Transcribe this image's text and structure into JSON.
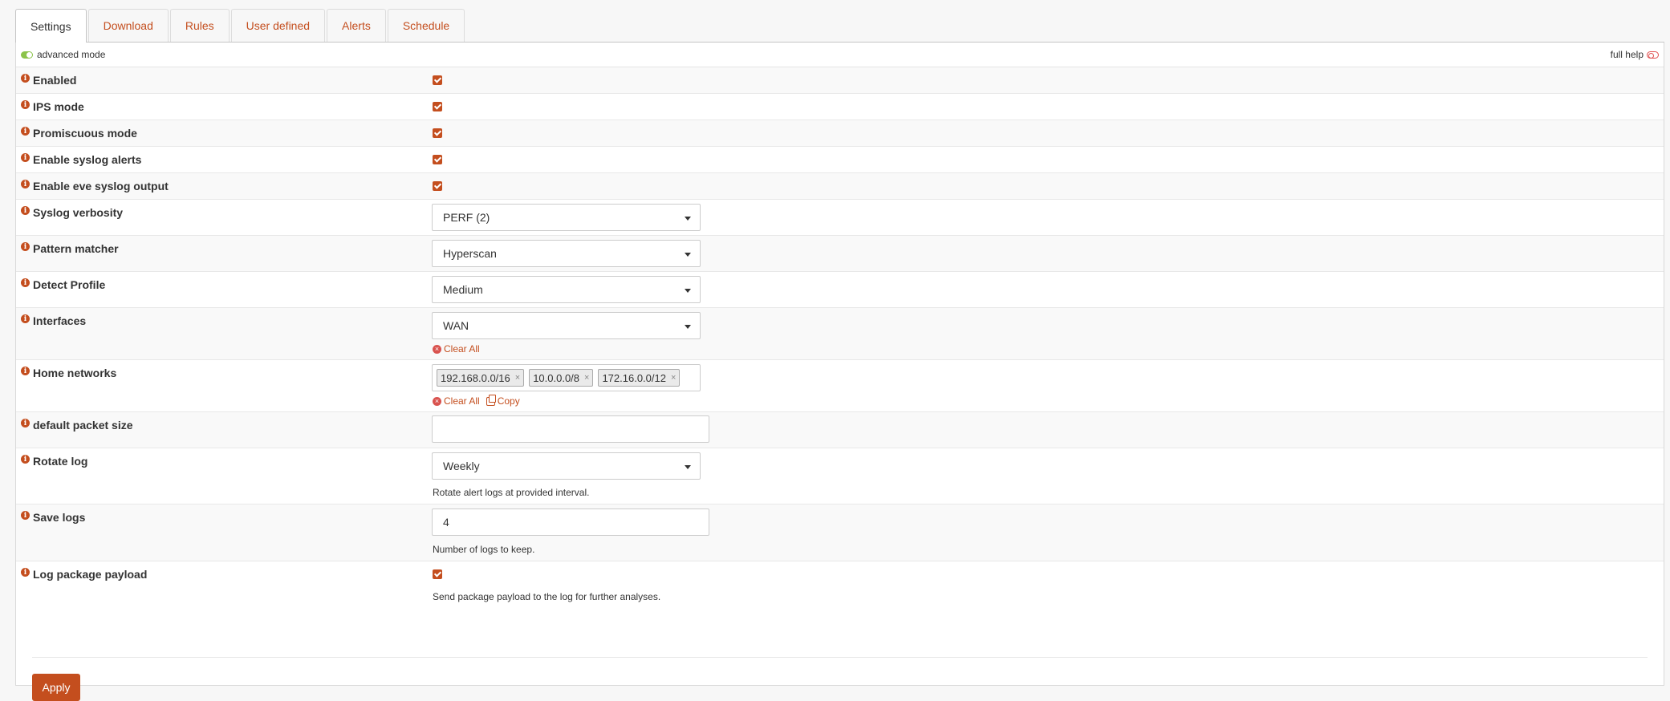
{
  "tabs": [
    {
      "label": "Settings",
      "active": true
    },
    {
      "label": "Download"
    },
    {
      "label": "Rules"
    },
    {
      "label": "User defined"
    },
    {
      "label": "Alerts"
    },
    {
      "label": "Schedule"
    }
  ],
  "modebar": {
    "advanced": "advanced mode",
    "full_help": "full help"
  },
  "fields": {
    "enabled": {
      "label": "Enabled",
      "checked": true
    },
    "ips_mode": {
      "label": "IPS mode",
      "checked": true
    },
    "promiscuous": {
      "label": "Promiscuous mode",
      "checked": true
    },
    "syslog_alerts": {
      "label": "Enable syslog alerts",
      "checked": true
    },
    "eve_syslog": {
      "label": "Enable eve syslog output",
      "checked": true
    },
    "syslog_verbosity": {
      "label": "Syslog verbosity",
      "value": "PERF (2)"
    },
    "pattern_matcher": {
      "label": "Pattern matcher",
      "value": "Hyperscan"
    },
    "detect_profile": {
      "label": "Detect Profile",
      "value": "Medium"
    },
    "interfaces": {
      "label": "Interfaces",
      "value": "WAN",
      "clear_all": "Clear All"
    },
    "home_networks": {
      "label": "Home networks",
      "tags": [
        "192.168.0.0/16",
        "10.0.0.0/8",
        "172.16.0.0/12"
      ],
      "clear_all": "Clear All",
      "copy": "Copy"
    },
    "packet_size": {
      "label": "default packet size",
      "value": ""
    },
    "rotate_log": {
      "label": "Rotate log",
      "value": "Weekly",
      "help": "Rotate alert logs at provided interval."
    },
    "save_logs": {
      "label": "Save logs",
      "value": "4",
      "help": "Number of logs to keep."
    },
    "log_payload": {
      "label": "Log package payload",
      "checked": true,
      "help": "Send package payload to the log for further analyses."
    }
  },
  "apply_label": "Apply",
  "colors": {
    "accent": "#c44e1e",
    "toggle_on": "#8bc34a",
    "danger": "#d9534f"
  }
}
